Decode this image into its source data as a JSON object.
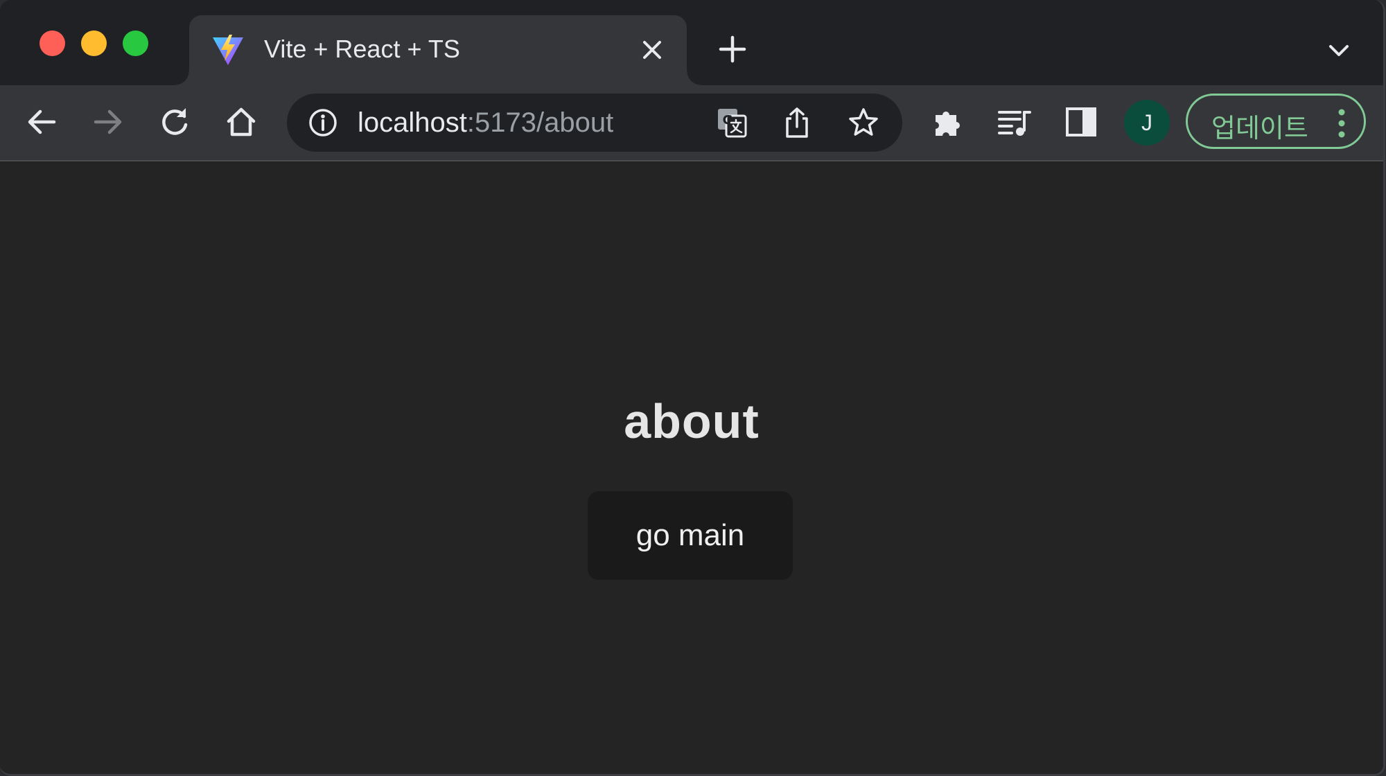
{
  "browser": {
    "tab": {
      "title": "Vite + React + TS",
      "favicon": "vite-logo-icon"
    },
    "address_bar": {
      "host": "localhost",
      "path": ":5173/about"
    },
    "profile": {
      "initial": "J"
    },
    "update_button": {
      "label": "업데이트"
    },
    "icons": {
      "back": "arrow-left-icon",
      "forward": "arrow-right-icon",
      "reload": "reload-icon",
      "home": "home-icon",
      "site_info": "info-icon",
      "translate": "translate-icon",
      "share": "share-icon",
      "bookmark": "star-icon",
      "extensions": "puzzle-icon",
      "media": "media-queue-icon",
      "side_panel": "side-panel-icon",
      "menu": "more-vertical-icon"
    },
    "colors": {
      "accent_green": "#81c995",
      "avatar_bg": "#0b4d3c",
      "page_bg": "#242424"
    }
  },
  "page": {
    "heading": "about",
    "button_label": "go main"
  }
}
